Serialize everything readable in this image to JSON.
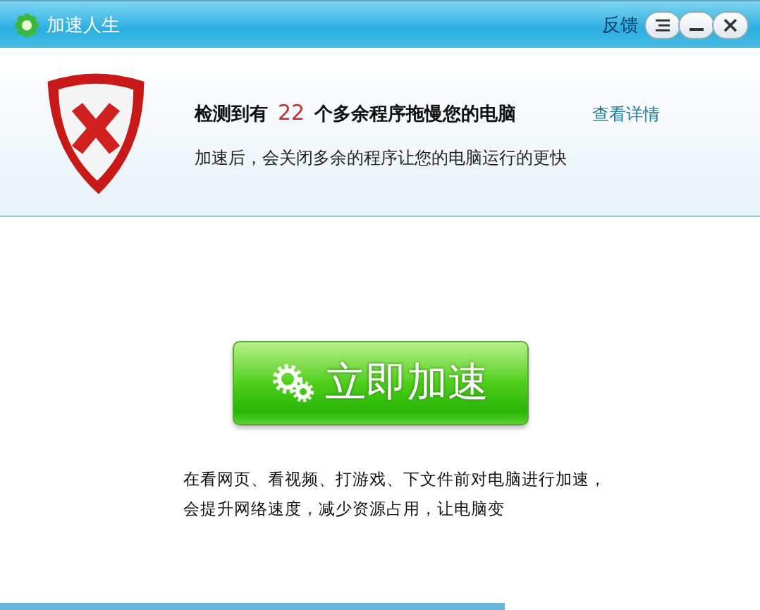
{
  "window": {
    "title": "加速人生",
    "feedback": "反馈"
  },
  "alert": {
    "headline_before": "检测到有",
    "count": "22",
    "headline_after": "个多余程序拖慢您的电脑",
    "details_link": "查看详情",
    "subtitle": "加速后，会关闭多余的程序让您的电脑运行的更快"
  },
  "accelerate_button": {
    "label": "立即加速"
  },
  "description": [
    "在看网页、看视频、打游戏、下文件前对电脑进行加速，",
    "会提升网络速度，减少资源占用，让电脑变"
  ]
}
